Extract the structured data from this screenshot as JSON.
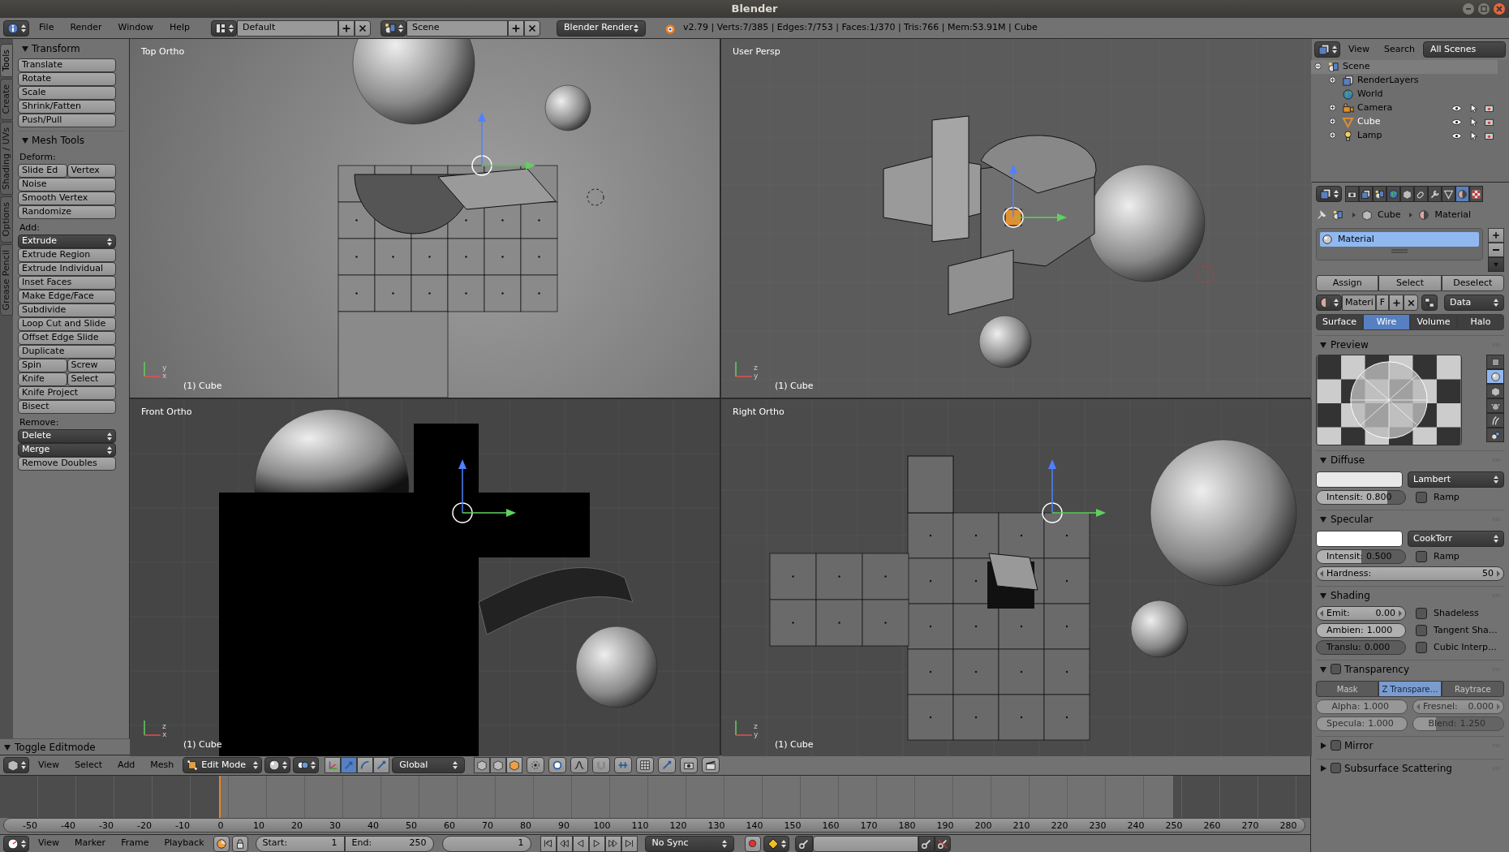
{
  "window": {
    "title": "Blender"
  },
  "info_header": {
    "menus": [
      "File",
      "Render",
      "Window",
      "Help"
    ],
    "screen_layout": "Default",
    "scene": "Scene",
    "render_engine": "Blender Render",
    "stats": "v2.79 | Verts:7/385 | Edges:7/753 | Faces:1/370 | Tris:766 | Mem:53.91M | Cube"
  },
  "tool_shelf": {
    "tabs": [
      {
        "label": "Tools",
        "selected": true
      },
      {
        "label": "Create",
        "selected": false
      },
      {
        "label": "Shading / UVs",
        "selected": false
      },
      {
        "label": "Options",
        "selected": false
      },
      {
        "label": "Grease Pencil",
        "selected": false
      }
    ],
    "panels": [
      {
        "title": "Transform",
        "items": [
          {
            "kind": "row",
            "buttons": [
              {
                "label": "Translate",
                "dropdown": false
              }
            ]
          },
          {
            "kind": "row",
            "buttons": [
              {
                "label": "Rotate",
                "dropdown": false
              }
            ]
          },
          {
            "kind": "row",
            "buttons": [
              {
                "label": "Scale",
                "dropdown": false
              }
            ]
          },
          {
            "kind": "row",
            "buttons": [
              {
                "label": "Shrink/Fatten",
                "dropdown": false
              }
            ]
          },
          {
            "kind": "row",
            "buttons": [
              {
                "label": "Push/Pull",
                "dropdown": false
              }
            ]
          }
        ]
      },
      {
        "title": "Mesh Tools",
        "items": [
          {
            "kind": "heading",
            "label": "Deform:"
          },
          {
            "kind": "row",
            "buttons": [
              {
                "label": "Slide Ed",
                "dropdown": false
              },
              {
                "label": "Vertex",
                "dropdown": false
              }
            ]
          },
          {
            "kind": "row",
            "buttons": [
              {
                "label": "Noise",
                "dropdown": false
              }
            ]
          },
          {
            "kind": "row",
            "buttons": [
              {
                "label": "Smooth Vertex",
                "dropdown": false
              }
            ]
          },
          {
            "kind": "row",
            "buttons": [
              {
                "label": "Randomize",
                "dropdown": false
              }
            ]
          },
          {
            "kind": "heading",
            "label": "Add:"
          },
          {
            "kind": "row",
            "buttons": [
              {
                "label": "Extrude",
                "dropdown": true
              }
            ]
          },
          {
            "kind": "row",
            "buttons": [
              {
                "label": "Extrude Region",
                "dropdown": false
              }
            ]
          },
          {
            "kind": "row",
            "buttons": [
              {
                "label": "Extrude Individual",
                "dropdown": false
              }
            ]
          },
          {
            "kind": "row",
            "buttons": [
              {
                "label": "Inset Faces",
                "dropdown": false
              }
            ]
          },
          {
            "kind": "row",
            "buttons": [
              {
                "label": "Make Edge/Face",
                "dropdown": false
              }
            ]
          },
          {
            "kind": "row",
            "buttons": [
              {
                "label": "Subdivide",
                "dropdown": false
              }
            ]
          },
          {
            "kind": "row",
            "buttons": [
              {
                "label": "Loop Cut and Slide",
                "dropdown": false
              }
            ]
          },
          {
            "kind": "row",
            "buttons": [
              {
                "label": "Offset Edge Slide",
                "dropdown": false
              }
            ]
          },
          {
            "kind": "row",
            "buttons": [
              {
                "label": "Duplicate",
                "dropdown": false
              }
            ]
          },
          {
            "kind": "row",
            "buttons": [
              {
                "label": "Spin",
                "dropdown": false
              },
              {
                "label": "Screw",
                "dropdown": false
              }
            ]
          },
          {
            "kind": "row",
            "buttons": [
              {
                "label": "Knife",
                "dropdown": false
              },
              {
                "label": "Select",
                "dropdown": false
              }
            ]
          },
          {
            "kind": "row",
            "buttons": [
              {
                "label": "Knife Project",
                "dropdown": false
              }
            ]
          },
          {
            "kind": "row",
            "buttons": [
              {
                "label": "Bisect",
                "dropdown": false
              }
            ]
          },
          {
            "kind": "heading",
            "label": "Remove:"
          },
          {
            "kind": "row",
            "buttons": [
              {
                "label": "Delete",
                "dropdown": true
              }
            ]
          },
          {
            "kind": "row",
            "buttons": [
              {
                "label": "Merge",
                "dropdown": true
              }
            ]
          },
          {
            "kind": "row",
            "buttons": [
              {
                "label": "Remove Doubles",
                "dropdown": false
              }
            ]
          }
        ]
      }
    ],
    "operator_panel": "Toggle Editmode"
  },
  "viewports": [
    {
      "label": "Top Ortho",
      "footer": "(1) Cube",
      "axes": [
        "y",
        "x"
      ]
    },
    {
      "label": "User Persp",
      "footer": "(1) Cube",
      "axes": [
        "z",
        "y"
      ]
    },
    {
      "label": "Front Ortho",
      "footer": "(1) Cube",
      "axes": [
        "z",
        "x"
      ]
    },
    {
      "label": "Right Ortho",
      "footer": "(1) Cube",
      "axes": [
        "z",
        "y"
      ]
    }
  ],
  "view3d_header": {
    "menus": [
      "View",
      "Select",
      "Add",
      "Mesh"
    ],
    "mode": "Edit Mode",
    "orientation": "Global",
    "manipulators": [
      {
        "selected": false
      },
      {
        "selected": true
      },
      {
        "selected": false
      },
      {
        "selected": false
      }
    ],
    "select_modes": [
      {
        "selected": false
      },
      {
        "selected": false
      },
      {
        "selected": true
      }
    ]
  },
  "timeline": {
    "ruler": [
      "-50",
      "-40",
      "-30",
      "-20",
      "-10",
      "0",
      "10",
      "20",
      "30",
      "40",
      "50",
      "60",
      "70",
      "80",
      "90",
      "100",
      "110",
      "120",
      "130",
      "140",
      "150",
      "160",
      "170",
      "180",
      "190",
      "200",
      "210",
      "220",
      "230",
      "240",
      "250",
      "260",
      "270",
      "280"
    ],
    "menus": [
      "View",
      "Marker",
      "Frame",
      "Playback"
    ],
    "start_label": "Start:",
    "start": "1",
    "end_label": "End:",
    "end": "250",
    "current_frame": "1",
    "sync": "No Sync"
  },
  "outliner": {
    "menus": [
      "View",
      "Search"
    ],
    "display": "All Scenes",
    "tree": [
      {
        "label": "Scene",
        "selected": false,
        "children": [
          {
            "label": "RenderLayers",
            "selected": false
          },
          {
            "label": "World",
            "selected": false
          },
          {
            "label": "Camera",
            "selected": false
          },
          {
            "label": "Cube",
            "selected": true
          },
          {
            "label": "Lamp",
            "selected": false
          }
        ]
      }
    ]
  },
  "properties": {
    "tabs": [
      {
        "selected": false
      },
      {
        "selected": false
      },
      {
        "selected": false
      },
      {
        "selected": false
      },
      {
        "selected": false
      },
      {
        "selected": false
      },
      {
        "selected": false
      },
      {
        "selected": false
      },
      {
        "selected": true
      },
      {
        "selected": false
      }
    ],
    "breadcrumb": [
      "Cube",
      "Material"
    ],
    "slots": [
      {
        "label": "Material",
        "selected": true
      }
    ],
    "slot_buttons": [
      "Assign",
      "Select",
      "Deselect"
    ],
    "id_block": {
      "name": "Materi",
      "fake_user": "F",
      "link": "Data"
    },
    "type_tabs": [
      {
        "label": "Surface",
        "selected": false
      },
      {
        "label": "Wire",
        "selected": true
      },
      {
        "label": "Volume",
        "selected": false
      },
      {
        "label": "Halo",
        "selected": false
      }
    ],
    "preview": {
      "title": "Preview",
      "shapes": [
        {
          "selected": false
        },
        {
          "selected": true
        },
        {
          "selected": false
        },
        {
          "selected": false
        },
        {
          "selected": false
        },
        {
          "selected": false
        }
      ]
    },
    "diffuse": {
      "title": "Diffuse",
      "color": "#e8e8e8",
      "shader": "Lambert",
      "intensity": {
        "label": "Intensit:",
        "value": "0.800",
        "level": 0.8
      },
      "ramp": {
        "label": "Ramp",
        "checked": false
      }
    },
    "specular": {
      "title": "Specular",
      "color": "#ffffff",
      "shader": "CookTorr",
      "intensity": {
        "label": "Intensit:",
        "value": "0.500",
        "level": 0.5
      },
      "ramp": {
        "label": "Ramp",
        "checked": false
      },
      "hardness": {
        "label": "Hardness:",
        "value": "50"
      }
    },
    "shading": {
      "title": "Shading",
      "fields": [
        {
          "kind": "number",
          "label": "Emit:",
          "value": "0.00"
        },
        {
          "kind": "slider",
          "label": "Ambien:",
          "value": "1.000",
          "level": 1
        },
        {
          "kind": "slider",
          "label": "Translu:",
          "value": "0.000",
          "level": 0
        }
      ],
      "checks": [
        {
          "label": "Shadeless",
          "checked": false
        },
        {
          "label": "Tangent Sha…",
          "checked": false
        },
        {
          "label": "Cubic Interp…",
          "checked": false
        }
      ]
    },
    "transparency": {
      "title": "Transparency",
      "checked": false,
      "methods": [
        {
          "label": "Mask",
          "selected": false
        },
        {
          "label": "Z Transpare…",
          "selected": true
        },
        {
          "label": "Raytrace",
          "selected": false
        }
      ],
      "fields": [
        {
          "kind": "slider",
          "label": "Alpha:",
          "value": "1.000",
          "level": 1
        },
        {
          "kind": "number",
          "label": "Fresnel:",
          "value": "0.000"
        },
        {
          "kind": "slider",
          "label": "Specula:",
          "value": "1.000",
          "level": 1
        },
        {
          "kind": "slider",
          "label": "Blend:",
          "value": "1.250",
          "level": 0.25
        }
      ]
    },
    "collapsed": [
      {
        "title": "Mirror",
        "checked": false
      },
      {
        "title": "Subsurface Scattering",
        "checked": false
      }
    ]
  }
}
